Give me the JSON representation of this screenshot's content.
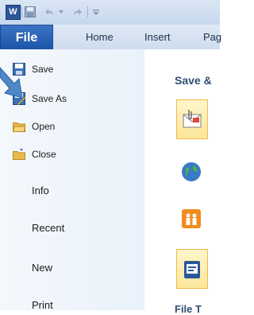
{
  "titlebar": {
    "app_icon_letter": "W"
  },
  "tabs": {
    "file": "File",
    "home": "Home",
    "insert": "Insert",
    "page_layout_partial": "Pag"
  },
  "backstage": {
    "menu": [
      {
        "label": "Save",
        "icon": "save-icon"
      },
      {
        "label": "Save As",
        "icon": "save-as-icon"
      },
      {
        "label": "Open",
        "icon": "open-folder-icon"
      },
      {
        "label": "Close",
        "icon": "close-folder-icon"
      }
    ],
    "sections": [
      "Info",
      "Recent",
      "New",
      "Print"
    ]
  },
  "right_panel": {
    "heading_partial": "Save &",
    "bottom_heading_partial": "File T"
  },
  "colors": {
    "accent": "#1d55a8",
    "backstage_bg": "#eef4fb",
    "tile_highlight": "#fde69a",
    "pointer": "#4f88c7"
  }
}
